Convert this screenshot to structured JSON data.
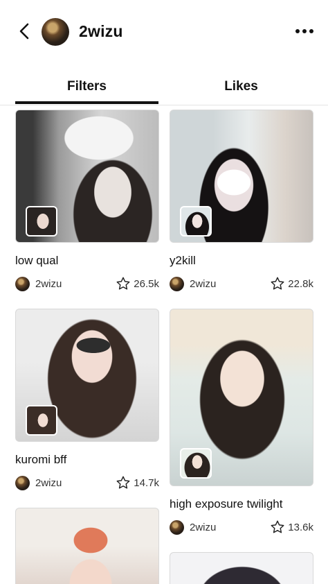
{
  "header": {
    "username": "2wizu",
    "back_icon": "chevron-left-icon",
    "more_icon": "more-horizontal-icon"
  },
  "tabs": [
    {
      "label": "Filters",
      "active": true
    },
    {
      "label": "Likes",
      "active": false
    }
  ],
  "cards": [
    {
      "title": "low qual",
      "creator": "2wizu",
      "likes": "26.5k"
    },
    {
      "title": "y2kill",
      "creator": "2wizu",
      "likes": "22.8k"
    },
    {
      "title": "kuromi bff",
      "creator": "2wizu",
      "likes": "14.7k"
    },
    {
      "title": "high exposure twilight",
      "creator": "2wizu",
      "likes": "13.6k"
    }
  ],
  "colors": {
    "text": "#111111",
    "muted": "#333333",
    "divider": "#e4e4e4",
    "background": "#ffffff"
  }
}
